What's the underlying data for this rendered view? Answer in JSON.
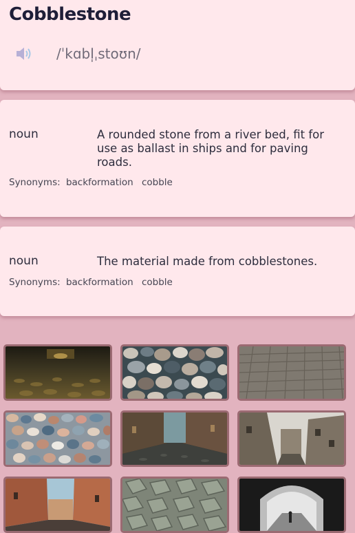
{
  "header": {
    "word": "Cobblestone",
    "phonetic": "/ˈkɑbl̩ˌstoʊn/",
    "speaker_icon": "speaker-icon"
  },
  "definitions": [
    {
      "part_of_speech": "noun",
      "text": "A rounded stone from a river bed, fit for use as ballast in ships and for paving roads.",
      "synonyms_label": "Synonyms:",
      "synonyms": [
        "backformation",
        "cobble"
      ]
    },
    {
      "part_of_speech": "noun",
      "text": "The material made from cobblestones.",
      "synonyms_label": "Synonyms:",
      "synonyms": [
        "backformation",
        "cobble"
      ]
    }
  ],
  "colors": {
    "background": "#e2b3bf",
    "card": "#ffe8ec",
    "thumb_border": "#9b6a72",
    "speaker": "#b7b0d6"
  }
}
